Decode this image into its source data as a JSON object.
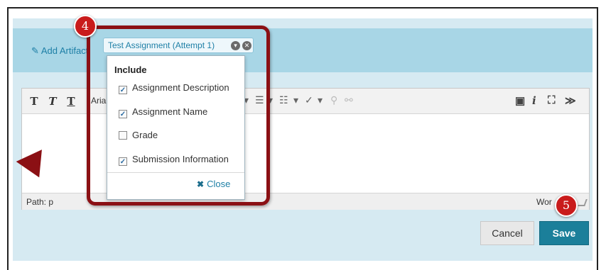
{
  "artifact": {
    "add_label": "Add Artifact",
    "chip_label": "Test Assignment (Attempt 1)"
  },
  "toolbar": {
    "bold": "T",
    "italic": "T",
    "underline": "T",
    "font_name": "Aria"
  },
  "dropdown": {
    "title": "Include",
    "items": [
      {
        "label": "Assignment Description",
        "checked": true
      },
      {
        "label": "Assignment Name",
        "checked": true
      },
      {
        "label": "Grade",
        "checked": false
      },
      {
        "label": "Submission Information",
        "checked": true
      }
    ],
    "close_label": "Close"
  },
  "editor": {
    "path_label": "Path: p",
    "word_count_label": "Wor"
  },
  "buttons": {
    "cancel": "Cancel",
    "save": "Save"
  },
  "markers": {
    "step4": "4",
    "step5": "5"
  },
  "colors": {
    "accent": "#1b7f9a",
    "callout": "#8b1014",
    "marker": "#c91b1b"
  }
}
